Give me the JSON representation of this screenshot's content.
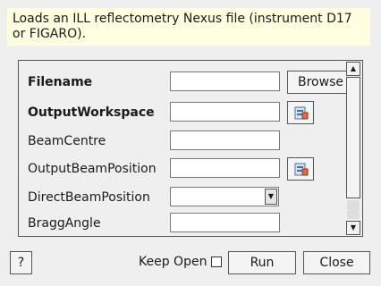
{
  "description": "Loads an ILL reflectometry Nexus file (instrument D17 or FIGARO).",
  "properties": [
    {
      "label": "Filename",
      "bold": true,
      "control": "text",
      "value": "",
      "button": "Browse"
    },
    {
      "label": "OutputWorkspace",
      "bold": true,
      "control": "text",
      "value": "",
      "button_icon": "workspace-icon"
    },
    {
      "label": "BeamCentre",
      "bold": false,
      "control": "text",
      "value": ""
    },
    {
      "label": "OutputBeamPosition",
      "bold": false,
      "control": "text",
      "value": "",
      "button_icon": "workspace-icon"
    },
    {
      "label": "DirectBeamPosition",
      "bold": false,
      "control": "combo",
      "value": ""
    },
    {
      "label": "BraggAngle",
      "bold": false,
      "control": "text",
      "value": ""
    }
  ],
  "footer": {
    "help_label": "?",
    "keep_open_label": "Keep Open",
    "keep_open_checked": false,
    "run_label": "Run",
    "close_label": "Close"
  }
}
